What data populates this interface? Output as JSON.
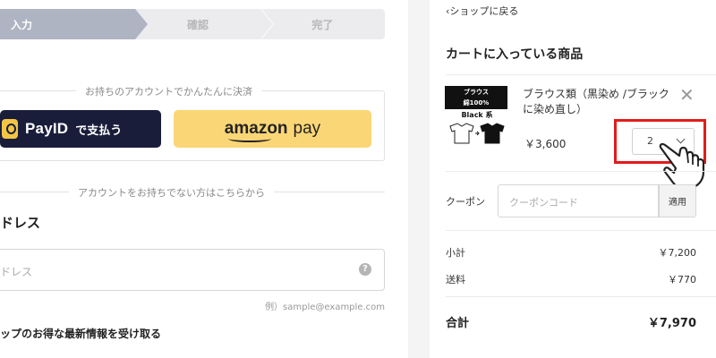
{
  "steps": [
    {
      "label": "入力",
      "state": "active"
    },
    {
      "label": "確認",
      "state": "inactive"
    },
    {
      "label": "完了",
      "state": "inactive"
    }
  ],
  "payment": {
    "account_heading": "お持ちのアカウントでかんたんに決済",
    "payid_brand": "PayID",
    "payid_suffix": "で支払う",
    "amazon_word": "amazon",
    "amazon_pay": "pay"
  },
  "guest_heading": "アカウントをお持ちでない方はこちらから",
  "email": {
    "label": "ドレス",
    "placeholder": "ドレス",
    "example": "例）sample@example.com",
    "help_glyph": "?"
  },
  "newsletter_label": "ップのお得な最新情報を受け取る",
  "cart": {
    "back_link": "ショップに戻る",
    "title": "カートに入っている商品",
    "item": {
      "thumb_line1": "ブラウス",
      "thumb_line2": "綿100%",
      "thumb_black": "Black 系",
      "name": "ブラウス類（黒染め /ブラックに染め直し）",
      "price": "￥3,600",
      "quantity": "2",
      "remove_glyph": "✕"
    },
    "coupon_label": "クーポン",
    "coupon_placeholder": "クーポンコード",
    "apply_label": "適用",
    "subtotal_label": "小計",
    "subtotal_value": "￥7,200",
    "shipping_label": "送料",
    "shipping_value": "￥770",
    "total_label": "合計",
    "total_value": "￥7,970"
  },
  "colors": {
    "highlight": "#e21b1b",
    "payid_bg": "#1a1d3a",
    "amazon_bg": "#fad676",
    "step_active": "#aeb4c2"
  }
}
